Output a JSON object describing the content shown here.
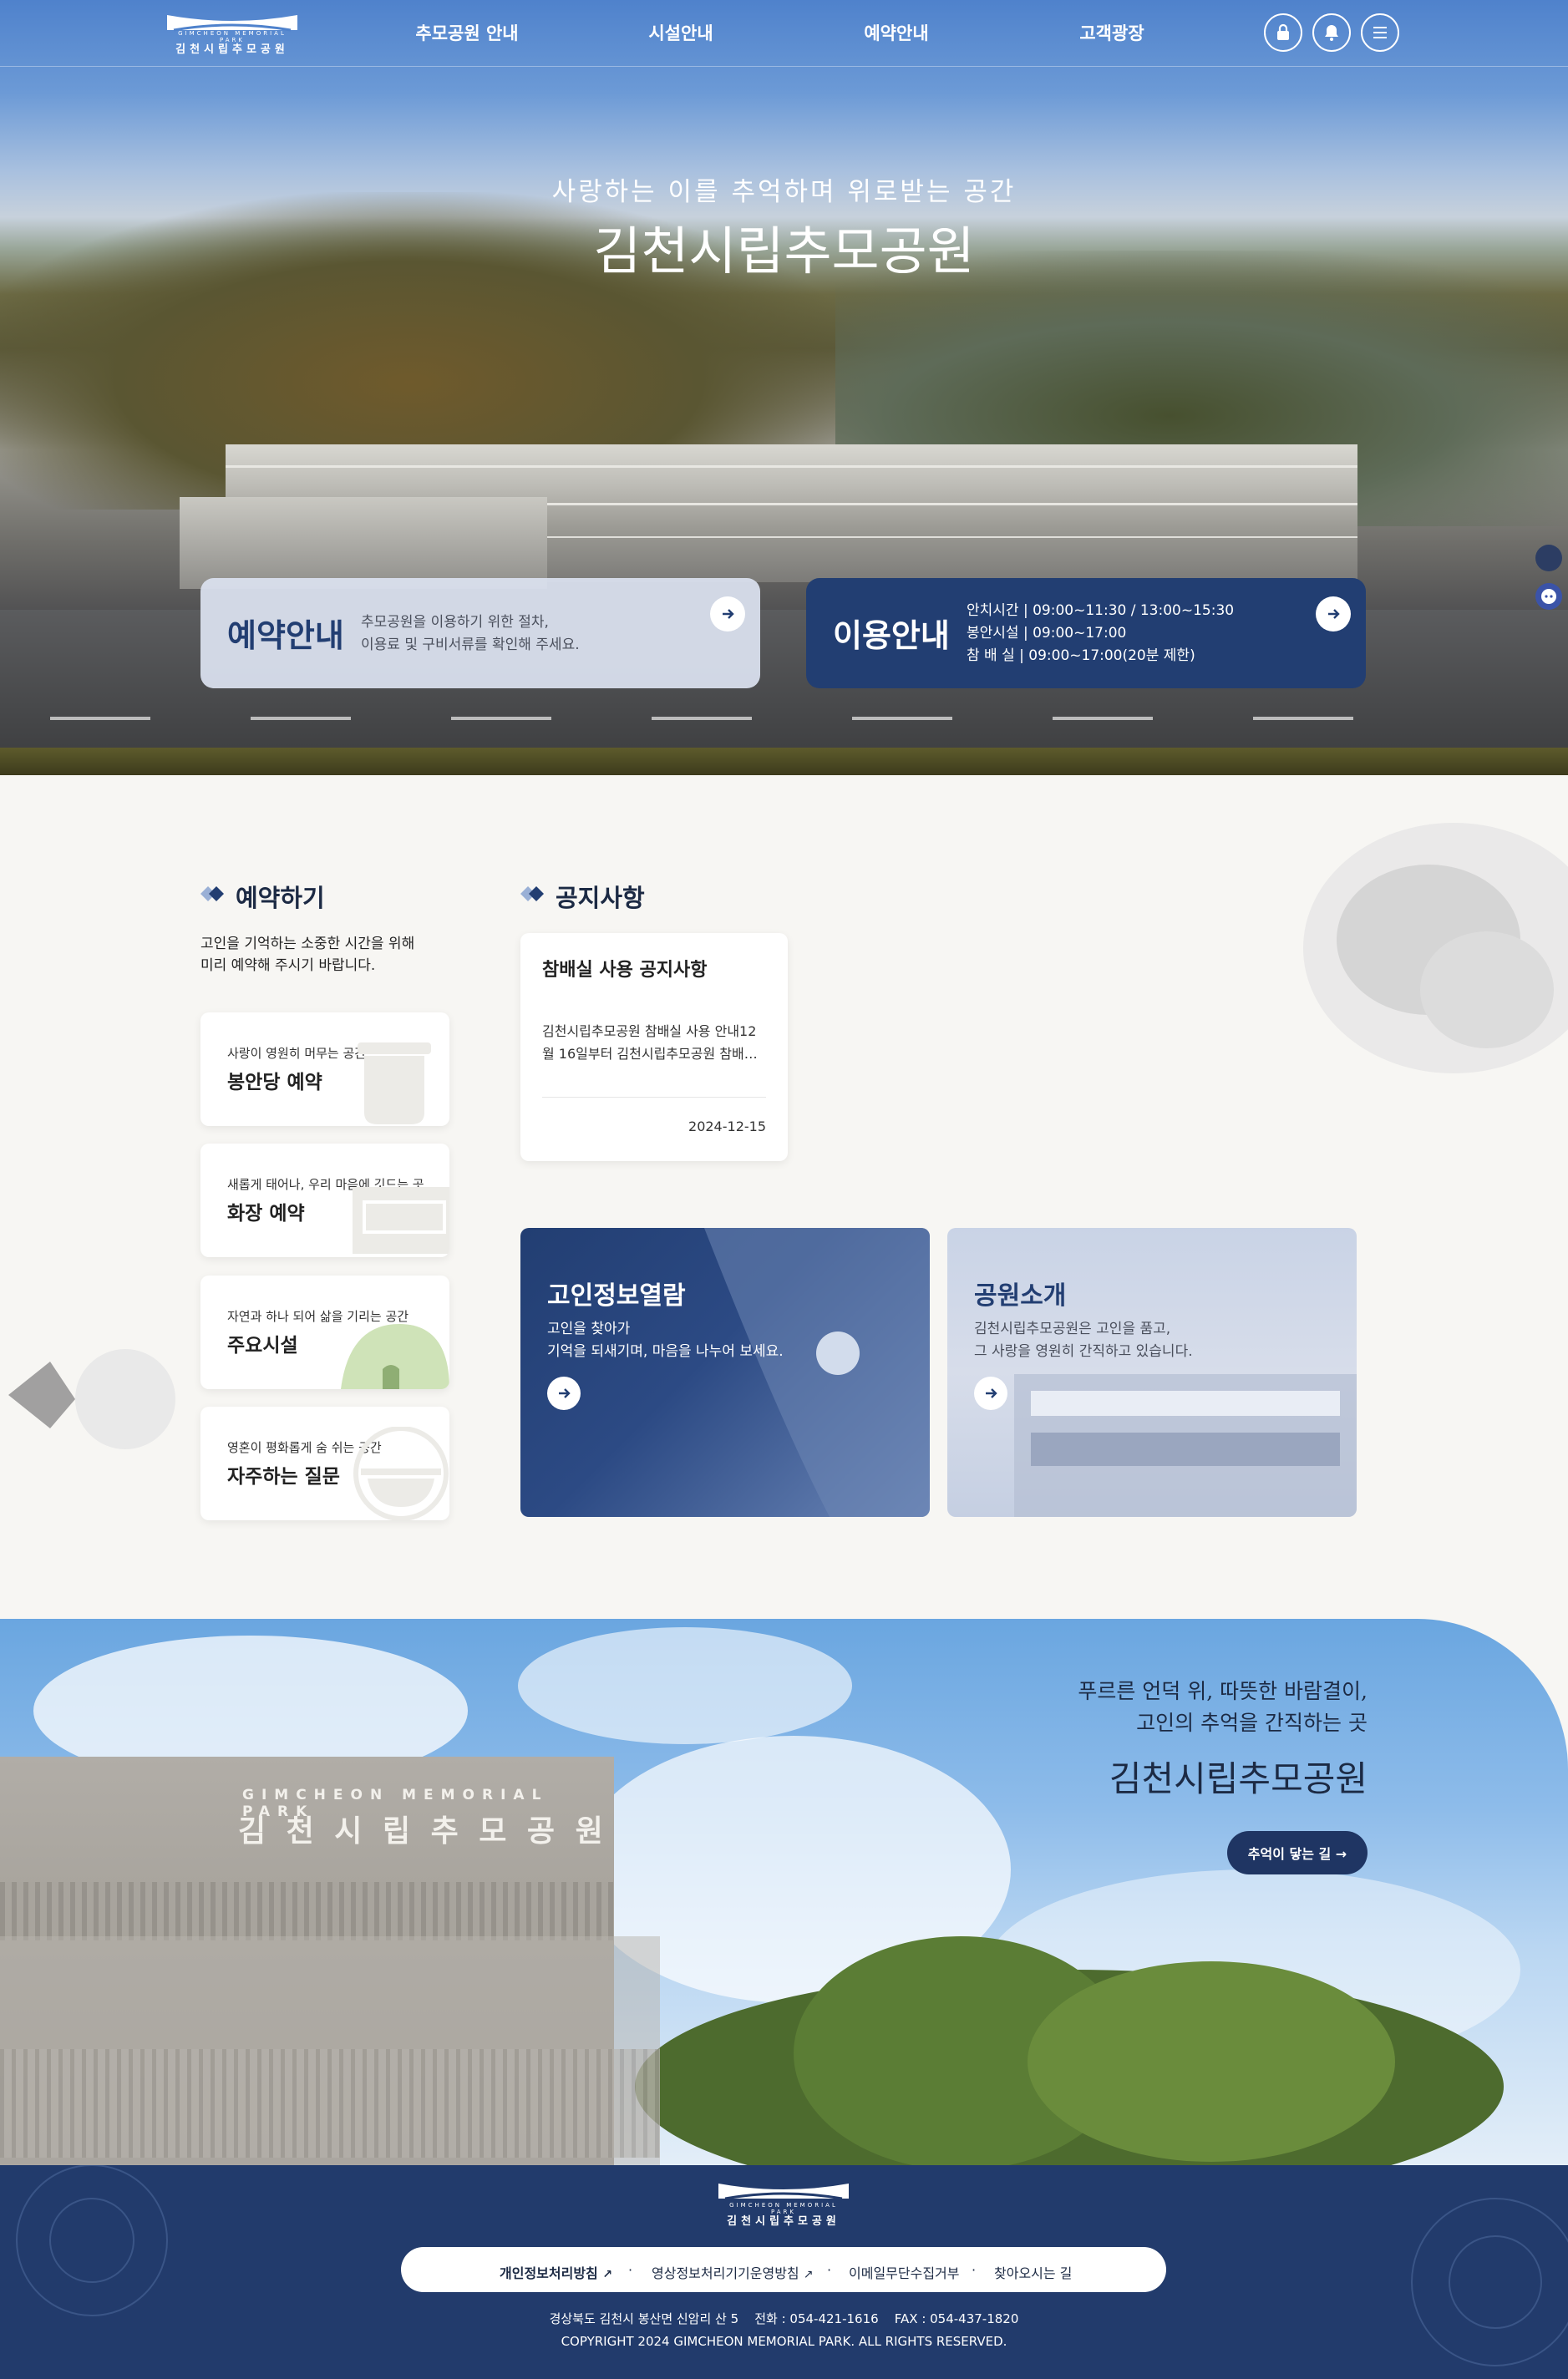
{
  "header": {
    "logo_en": "GIMCHEON MEMORIAL PARK",
    "logo_ko": "김천시립추모공원",
    "nav": [
      "추모공원 안내",
      "시설안내",
      "예약안내",
      "고객광장"
    ],
    "icons": [
      "lock-icon",
      "bell-icon",
      "menu-icon"
    ]
  },
  "hero": {
    "subtitle": "사랑하는 이를 추억하며 위로받는 공간",
    "title": "김천시립추모공원",
    "reservation_card": {
      "title": "예약안내",
      "desc_line1": "추모공원을 이용하기 위한 절차,",
      "desc_line2": "이용료 및 구비서류를 확인해 주세요."
    },
    "usage_card": {
      "title": "이용안내",
      "line1": "안치시간 | 09:00~11:30 / 13:00~15:30",
      "line2": "봉안시설 | 09:00~17:00",
      "line3": "참 배 실 | 09:00~17:00(20분 제한)"
    }
  },
  "reserve": {
    "title": "예약하기",
    "desc_line1": "고인을 기억하는 소중한 시간을 위해",
    "desc_line2": "미리 예약해 주시기 바랍니다.",
    "items": [
      {
        "sub": "사랑이 영원히 머무는 공간",
        "title": "봉안당 예약"
      },
      {
        "sub": "새롭게 태어나, 우리 마음에 깃드는 곳",
        "title": "화장 예약"
      },
      {
        "sub": "자연과 하나 되어 삶을 기리는 공간",
        "title": "주요시설"
      },
      {
        "sub": "영혼이 평화롭게 숨 쉬는 공간",
        "title": "자주하는 질문"
      }
    ]
  },
  "notice": {
    "title": "공지사항",
    "card": {
      "heading": "참배실 사용 공지사항",
      "body_line1": "김천시립추모공원 참배실 사용 안내12",
      "body_line2": "월 16일부터 김천시립추모공원 참배…",
      "date": "2024-12-15"
    }
  },
  "feature_cards": [
    {
      "title": "고인정보열람",
      "line1": "고인을 찾아가",
      "line2": "기억을 되새기며, 마음을 나누어 보세요."
    },
    {
      "title": "공원소개",
      "line1": "김천시립추모공원은 고인을 품고,",
      "line2": "그 사랑을 영원히 간직하고 있습니다."
    }
  ],
  "banner": {
    "line1": "푸르른 언덕 위, 따뜻한 바람결이,",
    "line2": "고인의 추억을 간직하는 곳",
    "title": "김천시립추모공원",
    "button": "추억이 닿는 길 →",
    "sign_en": "GIMCHEON MEMORIAL PARK",
    "sign_ko": "김 천 시 립 추 모 공 원"
  },
  "footer": {
    "logo_en": "GIMCHEON MEMORIAL PARK",
    "logo_ko": "김천시립추모공원",
    "links": [
      "개인정보처리방침",
      "영상정보처리기기운영방침",
      "이메일무단수집거부",
      "찾아오시는 길"
    ],
    "address": "경상북도 김천시 봉산면 신암리 산 5    전화 : 054-421-1616    FAX : 054-437-1820",
    "copyright": "COPYRIGHT 2024 GIMCHEON MEMORIAL PARK. ALL RIGHTS RESERVED."
  },
  "colors": {
    "navy": "#223b6c",
    "accent": "#2c4a8a",
    "bg": "#f7f6f3"
  }
}
